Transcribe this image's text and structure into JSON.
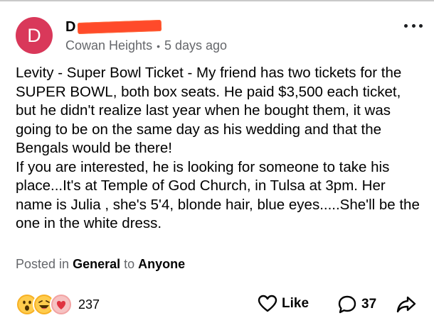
{
  "author": {
    "avatar_letter": "D",
    "name_initial": "D",
    "avatar_color": "#d9385a"
  },
  "post_meta": {
    "location": "Cowan Heights",
    "separator": "•",
    "time": "5 days ago"
  },
  "post_body": [
    "Levity - Super Bowl Ticket -  My friend has two tickets for the SUPER BOWL, both box seats. He paid $3,500 each ticket, but he didn't realize last year when he bought them, it was going to be on the same day as his wedding and that the Bengals would be there!",
    "If you are interested, he is looking for someone to take his place...It's at Temple of God Church, in Tulsa at 3pm. Her name is Julia , she's 5'4, blonde hair, blue eyes.....She'll be the one in the white dress."
  ],
  "posted_in": {
    "prefix": "Posted in",
    "group": "General",
    "joiner": "to",
    "audience": "Anyone"
  },
  "reactions": {
    "icons": [
      "wow-icon",
      "haha-icon",
      "love-icon"
    ],
    "count": "237"
  },
  "actions": {
    "like_label": "Like",
    "comment_count": "37",
    "share_icon": "share-arrow-icon"
  }
}
